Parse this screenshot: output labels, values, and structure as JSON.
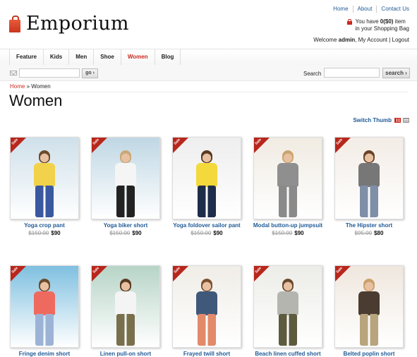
{
  "brand": {
    "name": "Emporium"
  },
  "toplinks": [
    "Home",
    "About",
    "Contact Us"
  ],
  "cart": {
    "line1_pre": "You have ",
    "count": "0($0)",
    "line1_post": " item",
    "line2": "in your Shopping Bag"
  },
  "welcome": {
    "pre": "Welcome ",
    "user": "admin",
    "sep1": ", ",
    "account": "My Account",
    "sep2": " | ",
    "logout": "Logout"
  },
  "nav": [
    "Feature",
    "Kids",
    "Men",
    "Shoe",
    "Women",
    "Blog"
  ],
  "nav_active": "Women",
  "newsletter": {
    "button": "go ›"
  },
  "search": {
    "label": "Search",
    "button": "search ›"
  },
  "breadcrumb": {
    "home": "Home",
    "sep": " » ",
    "current": "Women"
  },
  "page_title": "Women",
  "switch_label": "Switch Thumb",
  "sale_badge": "Sale",
  "products": [
    {
      "name": "Yoga crop pant",
      "old": "$150.00",
      "price": "$90",
      "bg": "#cfe0ea",
      "top": "#f2d24a",
      "bottom": "#3a58a0",
      "hair": "#6b4a2c"
    },
    {
      "name": "Yoga biker short",
      "old": "$150.00",
      "price": "$90",
      "bg": "#bfd7e4",
      "top": "#f5f5f5",
      "bottom": "#222222",
      "hair": "#c9a877"
    },
    {
      "name": "Yoga foldover sailor pant",
      "old": "$150.00",
      "price": "$90",
      "bg": "#eeeeee",
      "top": "#f3d93c",
      "bottom": "#1d2d4a",
      "hair": "#5b3a22"
    },
    {
      "name": "Modal button-up jumpsuit",
      "old": "$150.00",
      "price": "$90",
      "bg": "#f0ebe2",
      "top": "#8f8f8f",
      "bottom": "#8a8a8a",
      "hair": "#caa56e"
    },
    {
      "name": "The Hipster short",
      "old": "$95.00",
      "price": "$80",
      "bg": "#f3ece6",
      "top": "#777777",
      "bottom": "#7f8fa8",
      "hair": "#6a4328"
    },
    {
      "name": "Fringe denim short",
      "old": "",
      "price": "",
      "bg": "#7fc0e0",
      "top": "#ef6a5e",
      "bottom": "#9db3d6",
      "hair": "#6b4a2c"
    },
    {
      "name": "Linen pull-on short",
      "old": "",
      "price": "",
      "bg": "#b7d4c7",
      "top": "#f4f4f4",
      "bottom": "#7a6f4c",
      "hair": "#5a3a22"
    },
    {
      "name": "Frayed twill short",
      "old": "",
      "price": "",
      "bg": "#f0ede7",
      "top": "#40597a",
      "bottom": "#e28a6a",
      "hair": "#7a5030"
    },
    {
      "name": "Beach linen cuffed short",
      "old": "",
      "price": "",
      "bg": "#ecece8",
      "top": "#b5b5b0",
      "bottom": "#5e5a3e",
      "hair": "#6a4a2e"
    },
    {
      "name": "Belted poplin short",
      "old": "",
      "price": "",
      "bg": "#efe7de",
      "top": "#4a3c30",
      "bottom": "#b8a57d",
      "hair": "#c9a06a"
    }
  ]
}
